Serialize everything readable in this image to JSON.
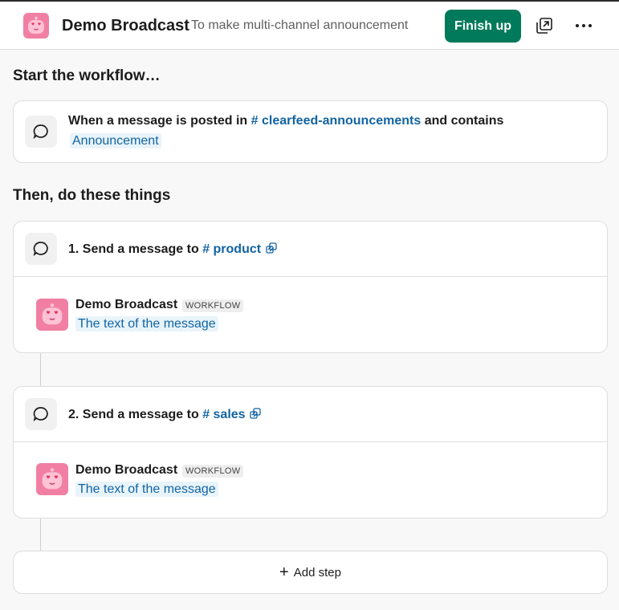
{
  "header": {
    "title": "Demo Broadcast",
    "subtitle": "To make multi-channel announcement",
    "finish_label": "Finish up",
    "avatar_icon": "bot-heart-eyes-icon",
    "actions": [
      "open-in-window-icon",
      "more-options-icon"
    ]
  },
  "trigger": {
    "heading": "Start the workflow…",
    "prefix": "When a message is posted in",
    "channel": "# clearfeed-announcements",
    "suffix": "and contains",
    "keyword": "Announcement"
  },
  "steps_heading": "Then, do these things",
  "steps": [
    {
      "label": "1. Send a message to",
      "channel": "# product",
      "sender": "Demo Broadcast",
      "badge": "WORKFLOW",
      "message": "The text of the message"
    },
    {
      "label": "2. Send a message to",
      "channel": "# sales",
      "sender": "Demo Broadcast",
      "badge": "WORKFLOW",
      "message": "The text of the message"
    }
  ],
  "add_step_label": "Add step",
  "colors": {
    "accent": "#007a5a",
    "link": "#1264a3",
    "avatar": "#f17fa3"
  }
}
